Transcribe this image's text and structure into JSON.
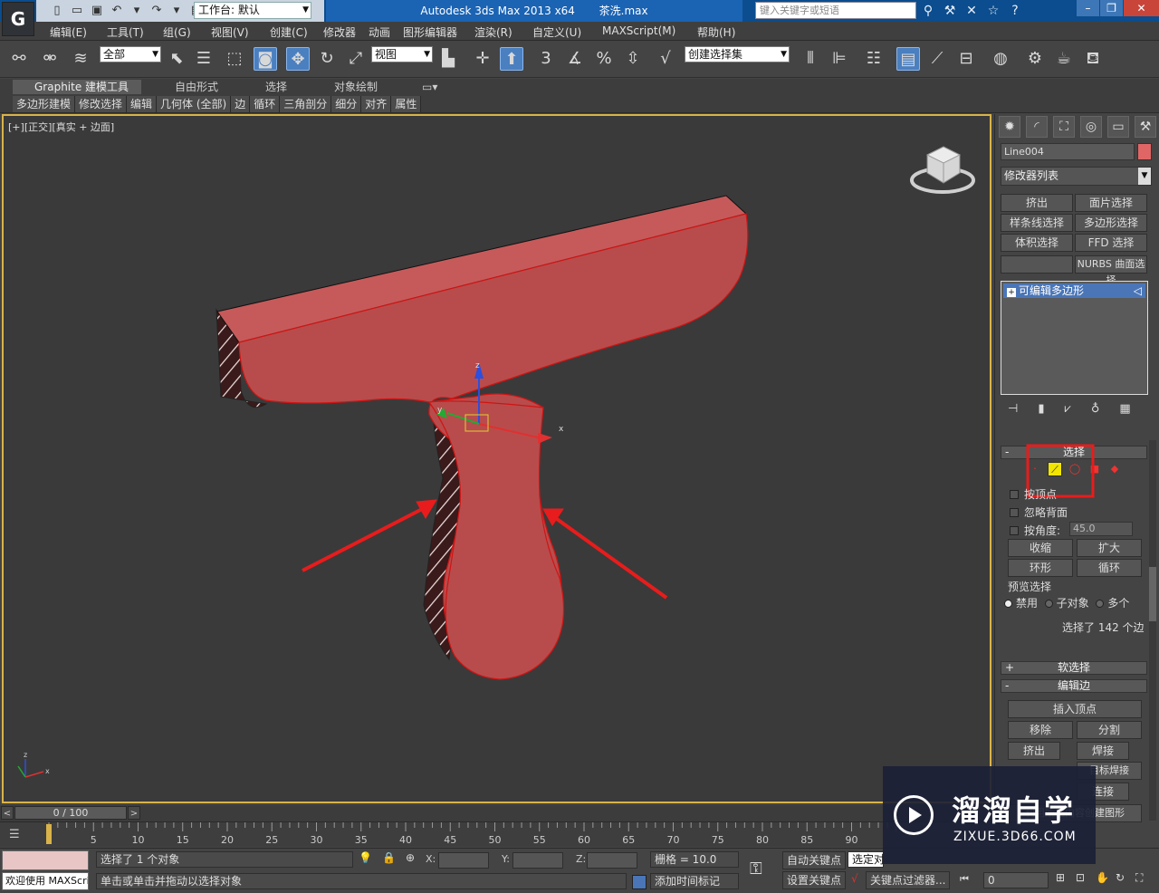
{
  "titlebar": {
    "workspace_label": "工作台: 默认",
    "app_title": "Autodesk 3ds Max  2013 x64",
    "file_name": "茶洗.max",
    "search_placeholder": "键入关键字或短语",
    "app_icon": "3ds-max-logo-icon"
  },
  "menubar": {
    "items": [
      "编辑(E)",
      "工具(T)",
      "组(G)",
      "视图(V)",
      "创建(C)",
      "修改器",
      "动画",
      "图形编辑器",
      "渲染(R)",
      "自定义(U)",
      "MAXScript(M)",
      "帮助(H)"
    ]
  },
  "toolbar": {
    "selection_filter": "全部",
    "reference_coord": "视图",
    "named_selection": "创建选择集",
    "snap_label": "3",
    "angle_snap_label": "%"
  },
  "ribbon": {
    "tabs": [
      "Graphite 建模工具",
      "自由形式",
      "选择",
      "对象绘制"
    ],
    "subtabs": [
      "多边形建模",
      "修改选择",
      "编辑",
      "几何体 (全部)",
      "边",
      "循环",
      "三角剖分",
      "细分",
      "对齐",
      "属性"
    ]
  },
  "viewport": {
    "label_plus": "[+]",
    "label_view": "[正交]",
    "label_shading": "[真实 + 边面]",
    "axis_x": "x",
    "axis_y": "y",
    "axis_z": "z"
  },
  "command_panel": {
    "object_name": "Line004",
    "object_color": "#e06666",
    "modifier_list": "修改器列表",
    "modifier_buttons": [
      "挤出",
      "面片选择",
      "样条线选择",
      "多边形选择",
      "体积选择",
      "FFD 选择",
      "",
      "NURBS 曲面选择"
    ],
    "stack_item": "可编辑多边形",
    "selection_rollout": "选择",
    "by_vertex": "按顶点",
    "ignore_backfacing": "忽略背面",
    "by_angle": "按角度:",
    "angle_value": "45.0",
    "shrink": "收缩",
    "grow": "扩大",
    "ring": "环形",
    "loop": "循环",
    "preview_selection": "预览选择",
    "preview_options": [
      "禁用",
      "子对象",
      "多个"
    ],
    "selected_count": "选择了 142 个边",
    "soft_selection": "软选择",
    "edit_edges": "编辑边",
    "insert_vertex": "插入顶点",
    "remove": "移除",
    "split": "分割",
    "extrude": "挤出",
    "weld": "焊接",
    "target_weld": "目标焊接",
    "connect": "连接",
    "create_shape": "利用所选内容创建图形"
  },
  "timeline": {
    "frame_counter": "0 / 100",
    "ticks": [
      "0",
      "5",
      "10",
      "15",
      "20",
      "25",
      "30",
      "35",
      "40",
      "45",
      "50",
      "55",
      "60",
      "65",
      "70",
      "75",
      "80",
      "85",
      "90"
    ]
  },
  "statusbar": {
    "welcome": "欢迎使用 MAXScri",
    "selection_status": "选择了 1 个对象",
    "prompt": "单击或单击并拖动以选择对象",
    "x_label": "X:",
    "y_label": "Y:",
    "z_label": "Z:",
    "grid": "栅格 = 10.0",
    "add_time_tag": "添加时间标记",
    "auto_key": "自动关键点",
    "set_key": "设置关键点",
    "selected_filter": "选定对",
    "key_filters": "关键点过滤器...",
    "frame_value": "0"
  },
  "watermark": {
    "title": "溜溜自学",
    "url": "ZIXUE.3D66.COM"
  },
  "colors": {
    "model_fill": "#b84c4c",
    "annotation_red": "#e81c1c",
    "viewport_bg": "#3a3a3a",
    "highlight_border": "#d9b34a"
  }
}
